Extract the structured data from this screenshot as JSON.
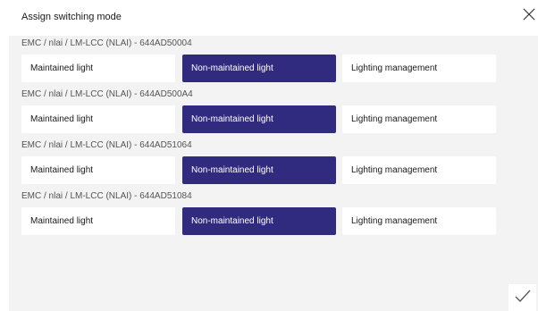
{
  "dialog": {
    "title": "Assign switching mode",
    "close_icon": "close-icon",
    "confirm_icon": "checkmark-icon"
  },
  "colors": {
    "selected": "#312b80",
    "panel": "#f3f3f3",
    "option": "#ffffff"
  },
  "devices": [
    {
      "label": "EMC / nlai / LM-LCC (NLAI) - 644AD50004",
      "options": [
        "Maintained light",
        "Non-maintained light",
        "Lighting management"
      ],
      "selected_index": 1
    },
    {
      "label": "EMC / nlai / LM-LCC (NLAI) - 644AD500A4",
      "options": [
        "Maintained light",
        "Non-maintained light",
        "Lighting management"
      ],
      "selected_index": 1
    },
    {
      "label": "EMC / nlai / LM-LCC (NLAI) - 644AD51064",
      "options": [
        "Maintained light",
        "Non-maintained light",
        "Lighting management"
      ],
      "selected_index": 1
    },
    {
      "label": "EMC / nlai / LM-LCC (NLAI) - 644AD51084",
      "options": [
        "Maintained light",
        "Non-maintained light",
        "Lighting management"
      ],
      "selected_index": 1
    }
  ]
}
